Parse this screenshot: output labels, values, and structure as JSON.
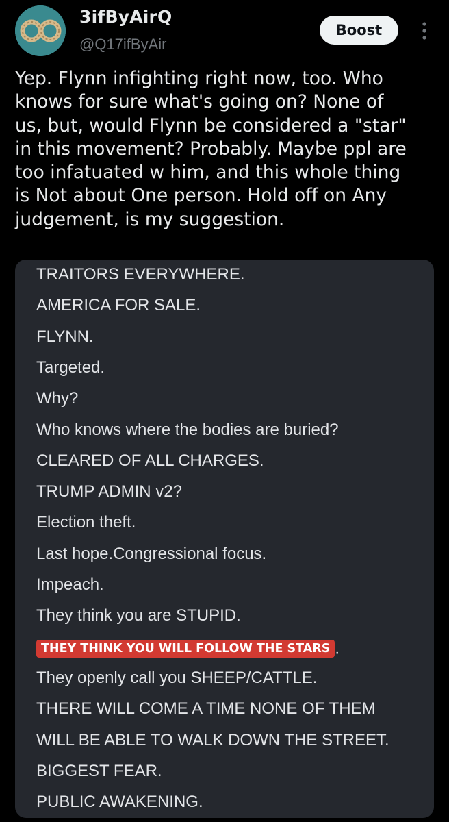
{
  "post": {
    "author": {
      "display_name": "3ifByAirQ",
      "handle": "@Q17ifByAir"
    },
    "boost_label": "Boost",
    "text": "Yep. Flynn infighting right now, too. Who knows for sure what's going on? None of us, but, would Flynn be considered a \"star\" in this movement? Probably. Maybe ppl are too infatuated w him, and this whole thing is Not about One person. Hold off on Any judgement, is my suggestion.",
    "text_lines": [
      "Yep. Flynn infighting right now, too. Who",
      "knows for sure what's going on? None of",
      "us, but, would Flynn be considered a \"star\"",
      "in this movement? Probably. Maybe ppl are",
      "too infatuated w him, and this whole thing",
      "is Not about One person. Hold off on Any",
      "judgement, is my suggestion."
    ]
  },
  "media": {
    "lines": [
      "TRAITORS EVERYWHERE.",
      "AMERICA FOR SALE.",
      "FLYNN.",
      "Targeted.",
      "Why?",
      "Who knows where the bodies are buried?",
      "CLEARED OF ALL CHARGES.",
      "TRUMP ADMIN v2?",
      "Election theft.",
      "Last hope.Congressional focus.",
      "Impeach.",
      "They think you are STUPID."
    ],
    "highlight": "THEY THINK YOU WILL FOLLOW THE STARS",
    "highlight_suffix": ".",
    "lines_after": [
      "They openly call you SHEEP/CATTLE.",
      "THERE WILL COME A TIME NONE OF THEM",
      "WILL BE ABLE TO WALK DOWN THE STREET.",
      "BIGGEST FEAR.",
      "PUBLIC AWAKENING."
    ]
  },
  "colors": {
    "background": "#000000",
    "text": "#e7e9ea",
    "handle": "#71767b",
    "media_bg": "#25282e",
    "highlight": "#d23a32"
  },
  "icons": {
    "avatar": "rope-rings-avatar",
    "more": "more-vertical-icon"
  }
}
